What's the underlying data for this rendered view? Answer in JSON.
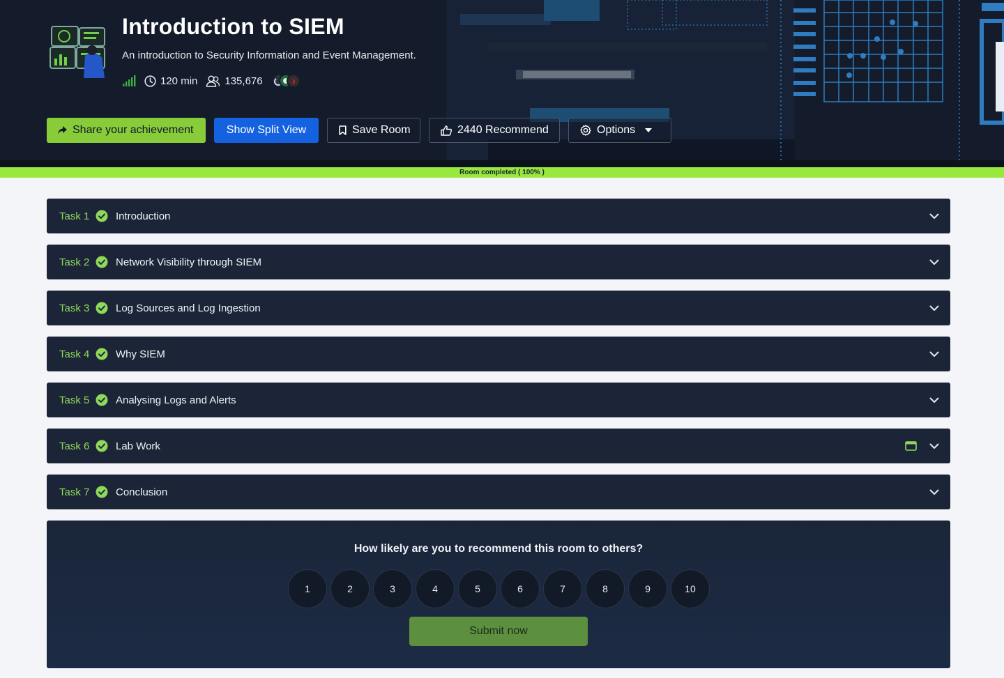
{
  "room": {
    "title": "Introduction to SIEM",
    "description": "An introduction to Security Information and Event Management.",
    "difficulty_icon": "signal-bars-icon",
    "duration": "120 min",
    "users": "135,676"
  },
  "actions": {
    "share_label": "Share your achievement",
    "split_view_label": "Show Split View",
    "save_label": "Save Room",
    "recommend_label": "2440 Recommend",
    "options_label": "Options"
  },
  "progress": {
    "label": "Room completed ( 100% )",
    "percent": 100
  },
  "tasks": [
    {
      "number": "Task 1",
      "title": "Introduction",
      "completed": true
    },
    {
      "number": "Task 2",
      "title": "Network Visibility through SIEM",
      "completed": true
    },
    {
      "number": "Task 3",
      "title": "Log Sources and Log Ingestion",
      "completed": true
    },
    {
      "number": "Task 4",
      "title": "Why SIEM",
      "completed": true
    },
    {
      "number": "Task 5",
      "title": "Analysing Logs and Alerts",
      "completed": true
    },
    {
      "number": "Task 6",
      "title": "Lab Work",
      "completed": true,
      "has_machine": true
    },
    {
      "number": "Task 7",
      "title": "Conclusion",
      "completed": true
    }
  ],
  "feedback": {
    "question": "How likely are you to recommend this room to others?",
    "scale": [
      "1",
      "2",
      "3",
      "4",
      "5",
      "6",
      "7",
      "8",
      "9",
      "10"
    ],
    "submit_label": "Submit now"
  },
  "colors": {
    "accent_green": "#98e83e",
    "task_bg": "#1c2538",
    "primary_blue": "#1562e0",
    "header_bg": "#141c2b"
  }
}
